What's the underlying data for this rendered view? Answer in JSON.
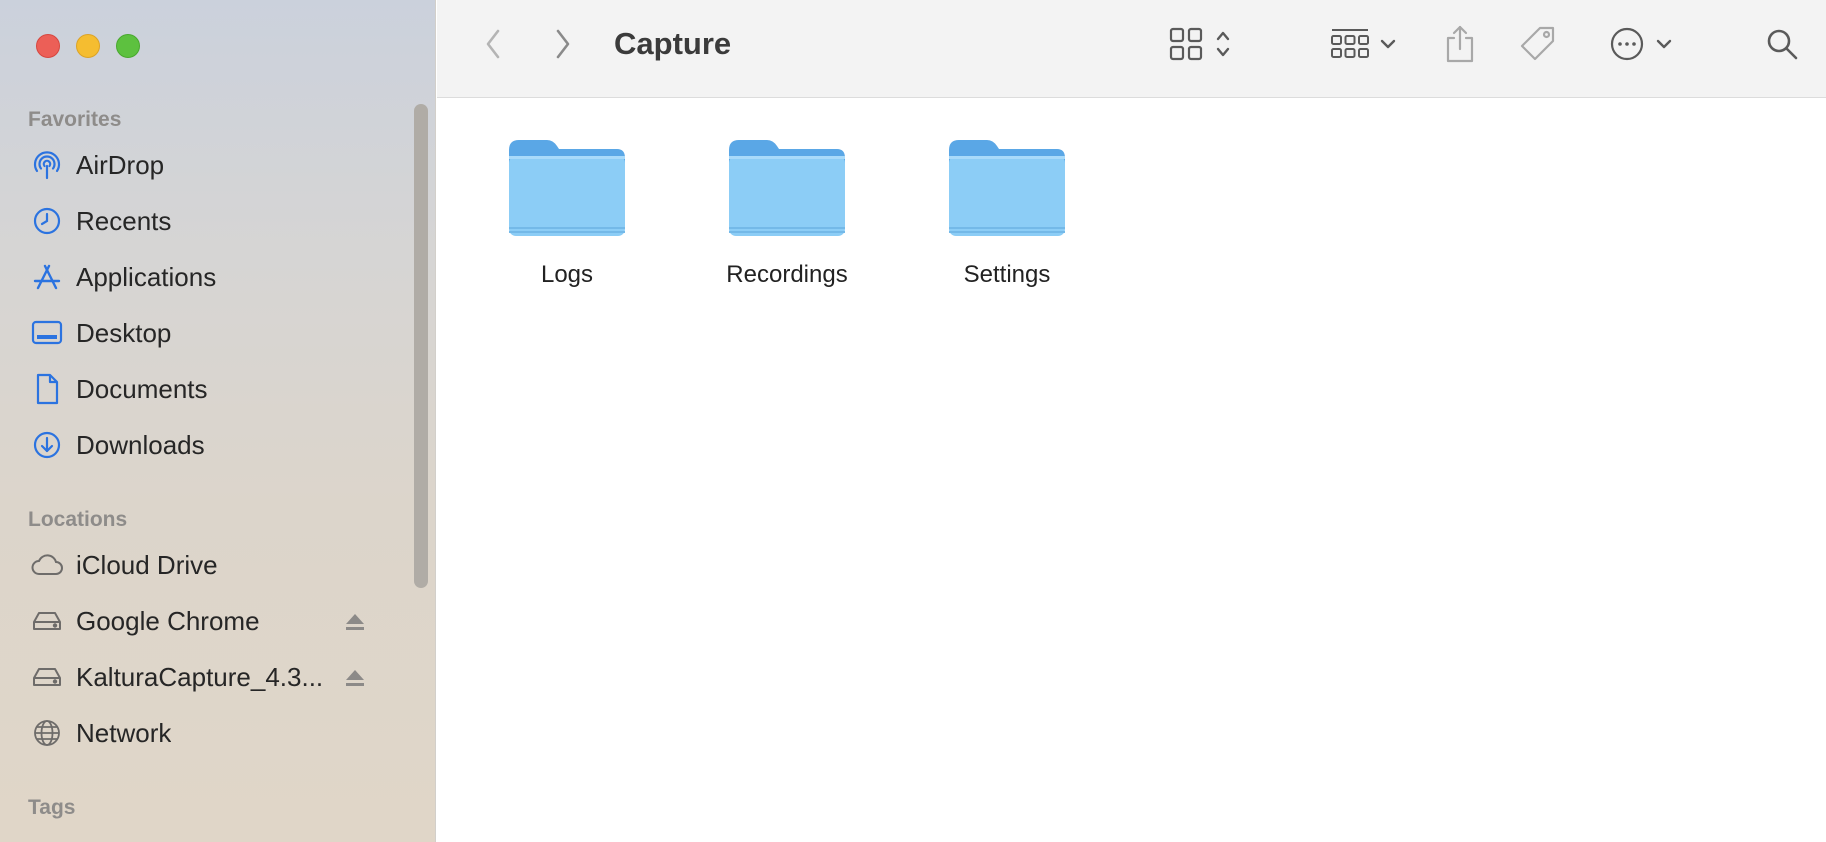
{
  "window": {
    "title": "Capture"
  },
  "colors": {
    "accent": "#2b73e0",
    "folder": "#8ccdf6",
    "folder_dark": "#5aa7e6",
    "close": "#ec5f57",
    "minimize": "#f5bd30",
    "maximize": "#5dc13f"
  },
  "sidebar": {
    "favorites_label": "Favorites",
    "locations_label": "Locations",
    "tags_label": "Tags",
    "favorites": [
      {
        "label": "AirDrop",
        "icon": "airdrop-icon"
      },
      {
        "label": "Recents",
        "icon": "clock-icon"
      },
      {
        "label": "Applications",
        "icon": "applications-icon"
      },
      {
        "label": "Desktop",
        "icon": "desktop-icon"
      },
      {
        "label": "Documents",
        "icon": "document-icon"
      },
      {
        "label": "Downloads",
        "icon": "download-icon"
      }
    ],
    "locations": [
      {
        "label": "iCloud Drive",
        "icon": "cloud-icon"
      },
      {
        "label": "Google Chrome",
        "icon": "disk-icon",
        "eject": true
      },
      {
        "label": "KalturaCapture_4.3...",
        "icon": "disk-icon",
        "eject": true
      },
      {
        "label": "Network",
        "icon": "globe-icon"
      }
    ]
  },
  "toolbar": {
    "back": "back-chevron-icon",
    "forward": "forward-chevron-icon",
    "view": "icon-grid-icon",
    "group": "group-grid-icon",
    "share": "share-icon",
    "tag": "tag-icon",
    "more": "ellipsis-circle-icon",
    "search": "search-icon"
  },
  "content": {
    "folders": [
      {
        "name": "Logs"
      },
      {
        "name": "Recordings"
      },
      {
        "name": "Settings"
      }
    ]
  }
}
